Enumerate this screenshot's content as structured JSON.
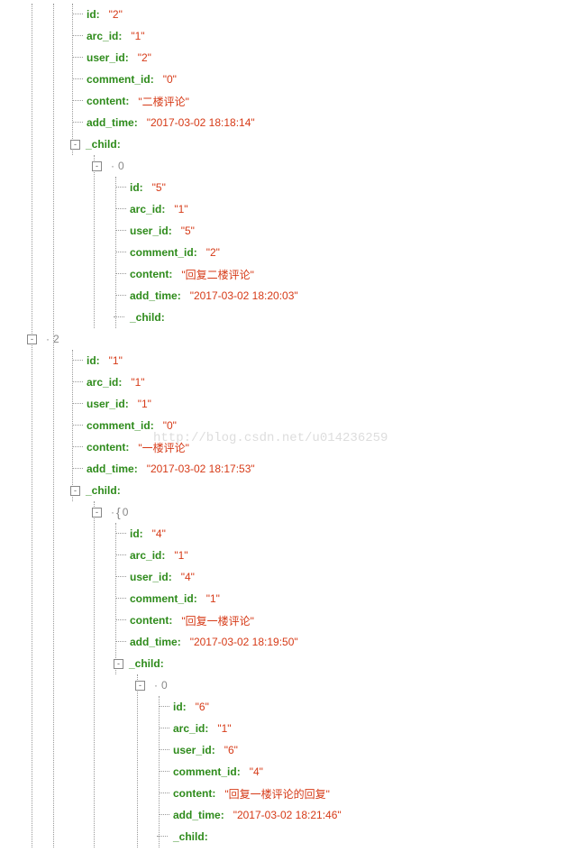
{
  "watermark": "http://blog.csdn.net/u014236259",
  "tree": [
    {
      "index_label": "",
      "fields": [
        {
          "key": "id",
          "value": "\"2\""
        },
        {
          "key": "arc_id",
          "value": "\"1\""
        },
        {
          "key": "user_id",
          "value": "\"2\""
        },
        {
          "key": "comment_id",
          "value": "\"0\""
        },
        {
          "key": "content",
          "value": "\"二楼评论\""
        },
        {
          "key": "add_time",
          "value": "\"2017-03-02 18:18:14\""
        }
      ],
      "child_label": "_child",
      "child": [
        {
          "index_label": "0",
          "fields": [
            {
              "key": "id",
              "value": "\"5\""
            },
            {
              "key": "arc_id",
              "value": "\"1\""
            },
            {
              "key": "user_id",
              "value": "\"5\""
            },
            {
              "key": "comment_id",
              "value": "\"2\""
            },
            {
              "key": "content",
              "value": "\"回复二楼评论\""
            },
            {
              "key": "add_time",
              "value": "\"2017-03-02 18:20:03\""
            }
          ],
          "child_label": "_child",
          "child": null
        }
      ]
    },
    {
      "index_label": "2",
      "fields": [
        {
          "key": "id",
          "value": "\"1\""
        },
        {
          "key": "arc_id",
          "value": "\"1\""
        },
        {
          "key": "user_id",
          "value": "\"1\""
        },
        {
          "key": "comment_id",
          "value": "\"0\""
        },
        {
          "key": "content",
          "value": "\"一楼评论\""
        },
        {
          "key": "add_time",
          "value": "\"2017-03-02 18:17:53\""
        }
      ],
      "child_label": "_child",
      "child": [
        {
          "index_label": "0",
          "brace_open": true,
          "fields": [
            {
              "key": "id",
              "value": "\"4\""
            },
            {
              "key": "arc_id",
              "value": "\"1\""
            },
            {
              "key": "user_id",
              "value": "\"4\""
            },
            {
              "key": "comment_id",
              "value": "\"1\""
            },
            {
              "key": "content",
              "value": "\"回复一楼评论\""
            },
            {
              "key": "add_time",
              "value": "\"2017-03-02 18:19:50\""
            }
          ],
          "child_label": "_child",
          "child": [
            {
              "index_label": "0",
              "fields": [
                {
                  "key": "id",
                  "value": "\"6\""
                },
                {
                  "key": "arc_id",
                  "value": "\"1\""
                },
                {
                  "key": "user_id",
                  "value": "\"6\""
                },
                {
                  "key": "comment_id",
                  "value": "\"4\""
                },
                {
                  "key": "content",
                  "value": "\"回复一楼评论的回复\""
                },
                {
                  "key": "add_time",
                  "value": "\"2017-03-02 18:21:46\""
                }
              ],
              "child_label": "_child",
              "child": null
            }
          ]
        }
      ]
    }
  ]
}
